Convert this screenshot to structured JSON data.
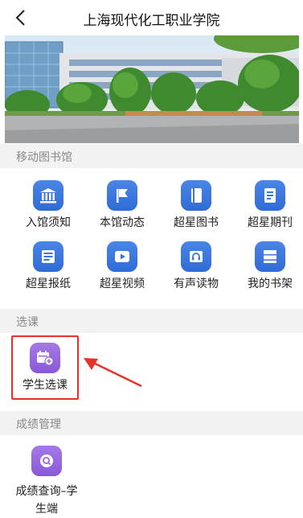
{
  "header": {
    "title": "上海现代化工职业学院"
  },
  "sections": [
    {
      "title": "移动图书馆",
      "items": [
        {
          "label": "入馆须知",
          "icon": "bank-icon",
          "color": "blue"
        },
        {
          "label": "本馆动态",
          "icon": "flag-icon",
          "color": "blue"
        },
        {
          "label": "超星图书",
          "icon": "book-icon",
          "color": "blue"
        },
        {
          "label": "超星期刊",
          "icon": "journal-icon",
          "color": "blue"
        },
        {
          "label": "超星报纸",
          "icon": "newspaper-icon",
          "color": "blue"
        },
        {
          "label": "超星视频",
          "icon": "play-icon",
          "color": "blue"
        },
        {
          "label": "有声读物",
          "icon": "audio-book-icon",
          "color": "blue"
        },
        {
          "label": "我的书架",
          "icon": "bookshelf-icon",
          "color": "blue"
        }
      ]
    },
    {
      "title": "选课",
      "items": [
        {
          "label": "学生选课",
          "icon": "calendar-add-icon",
          "color": "purple"
        }
      ]
    },
    {
      "title": "成绩管理",
      "items": [
        {
          "label": "成绩查询–学生端",
          "icon": "search-icon",
          "color": "purple"
        }
      ]
    }
  ],
  "colors": {
    "blue": "#3a76e0",
    "purple": "#9a68dc",
    "highlight": "#e8312a",
    "section_bg": "#f2f2f2"
  }
}
